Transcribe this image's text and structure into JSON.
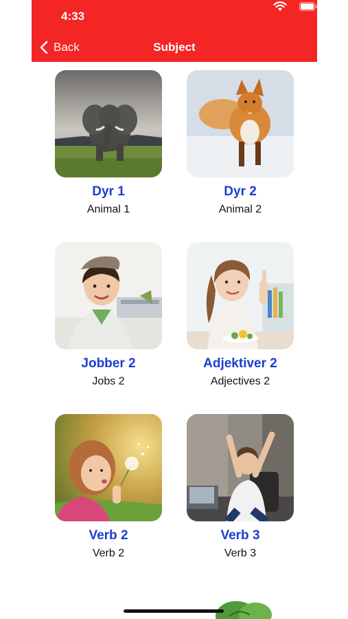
{
  "status_bar": {
    "time": "4:33"
  },
  "nav": {
    "back_label": "Back",
    "title": "Subject"
  },
  "subjects": [
    {
      "title": "Dyr 1",
      "subtitle": "Animal 1",
      "image": "elephant"
    },
    {
      "title": "Dyr 2",
      "subtitle": "Animal 2",
      "image": "fox"
    },
    {
      "title": "Jobber 2",
      "subtitle": "Jobs 2",
      "image": "flight-attendant"
    },
    {
      "title": "Adjektiver 2",
      "subtitle": "Adjectives 2",
      "image": "girl-thumbs-up"
    },
    {
      "title": "Verb 2",
      "subtitle": "Verb 2",
      "image": "girl-blowing-dandelion"
    },
    {
      "title": "Verb 3",
      "subtitle": "Verb 3",
      "image": "woman-celebrating"
    }
  ],
  "colors": {
    "nav_background": "#f42525",
    "title_blue": "#1a3ed0"
  }
}
